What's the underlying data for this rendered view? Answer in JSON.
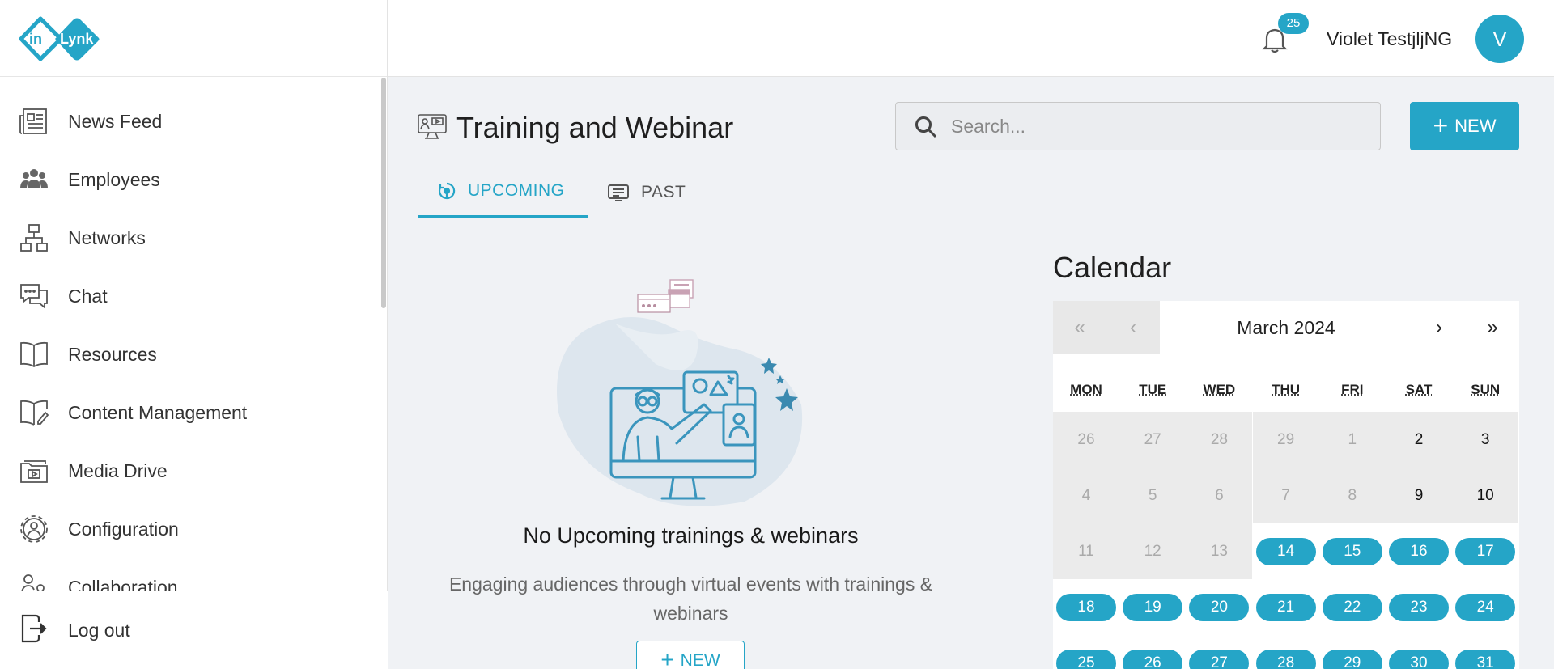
{
  "app": {
    "logo_text_left": "in",
    "logo_text_right": "Lynk",
    "brand_color": "#25a5c7"
  },
  "sidebar": {
    "items": [
      {
        "label": "News Feed",
        "icon": "newspaper-icon"
      },
      {
        "label": "Employees",
        "icon": "people-icon"
      },
      {
        "label": "Networks",
        "icon": "network-icon"
      },
      {
        "label": "Chat",
        "icon": "chat-icon"
      },
      {
        "label": "Resources",
        "icon": "book-icon"
      },
      {
        "label": "Content Management",
        "icon": "edit-book-icon"
      },
      {
        "label": "Media Drive",
        "icon": "folder-media-icon"
      },
      {
        "label": "Configuration",
        "icon": "gear-user-icon"
      },
      {
        "label": "Collaboration",
        "icon": "collaboration-icon"
      }
    ],
    "logout_label": "Log out"
  },
  "header": {
    "notification_count": "25",
    "user_name": "Violet TestjljNG",
    "avatar_initial": "V"
  },
  "main": {
    "title": "Training and Webinar",
    "search_placeholder": "Search...",
    "new_button_label": "NEW",
    "tabs": [
      {
        "label": "UPCOMING",
        "active": true
      },
      {
        "label": "PAST",
        "active": false
      }
    ],
    "empty_title": "No Upcoming trainings & webinars",
    "empty_description": "Engaging audiences through virtual events with trainings & webinars",
    "empty_new_label": "NEW"
  },
  "calendar": {
    "heading": "Calendar",
    "month_label": "March 2024",
    "nav": {
      "prev_year": "«",
      "prev_month": "‹",
      "next_month": "›",
      "next_year": "»"
    },
    "weekdays": [
      "MON",
      "TUE",
      "WED",
      "THU",
      "FRI",
      "SAT",
      "SUN"
    ],
    "weeks": [
      [
        "26",
        "27",
        "28",
        "29",
        "1",
        "2",
        "3"
      ],
      [
        "4",
        "5",
        "6",
        "7",
        "8",
        "9",
        "10"
      ],
      [
        "11",
        "12",
        "13",
        "14",
        "15",
        "16",
        "17"
      ],
      [
        "18",
        "19",
        "20",
        "21",
        "22",
        "23",
        "24"
      ],
      [
        "25",
        "26",
        "27",
        "28",
        "29",
        "30",
        "31"
      ]
    ]
  }
}
